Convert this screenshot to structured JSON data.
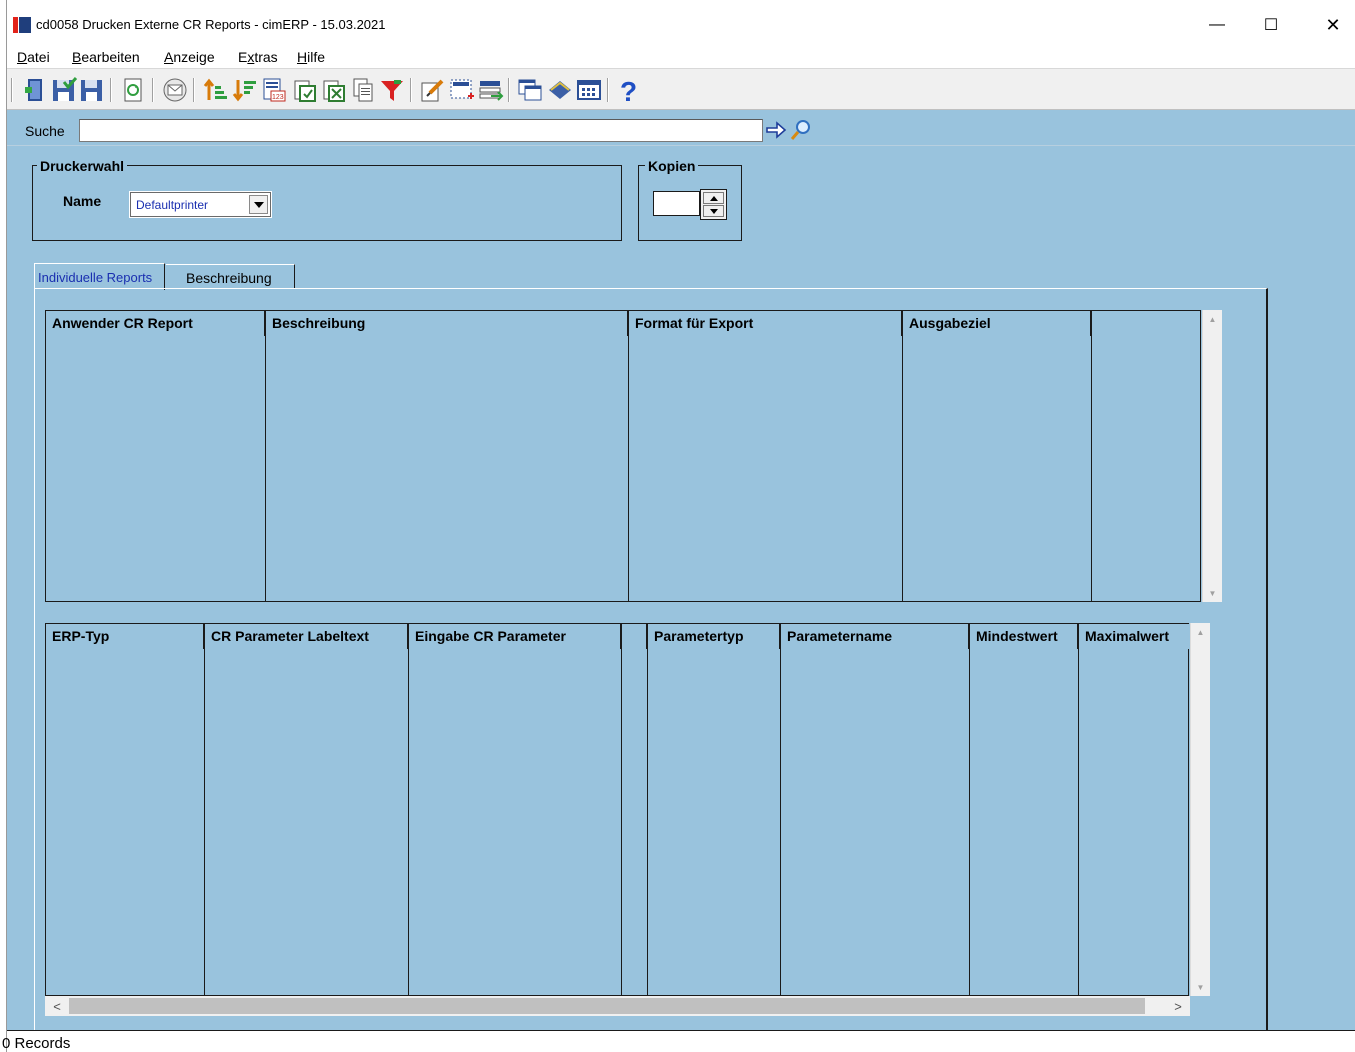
{
  "window": {
    "title": "cd0058 Drucken Externe CR Reports - cimERP - 15.03.2021",
    "minimize": "—",
    "maximize": "☐",
    "close": "✕"
  },
  "menu": [
    {
      "label_u": "D",
      "label_rest": "atei"
    },
    {
      "label_u": "B",
      "label_rest": "earbeiten"
    },
    {
      "label_u": "A",
      "label_rest": "nzeige"
    },
    {
      "label_pre": "E",
      "label_u": "x",
      "label_rest": "tras"
    },
    {
      "label_u": "H",
      "label_rest": "ilfe"
    }
  ],
  "toolbar_icons": [
    "exit-door-icon",
    "save-all-icon",
    "save-icon",
    "refresh-icon",
    "mail-icon",
    "sort-ascending-icon",
    "sort-descending-icon",
    "calendar-icon",
    "export-icon",
    "excel-icon",
    "copy-icon",
    "filter-icon",
    "edit-icon",
    "select-icon",
    "transfer-icon",
    "windows-icon",
    "book-icon",
    "grid-icon",
    "help-icon"
  ],
  "search": {
    "label": "Suche",
    "value": ""
  },
  "printer": {
    "group_title": "Druckerwahl",
    "name_label": "Name",
    "selected": "Defaultprinter"
  },
  "copies": {
    "group_title": "Kopien",
    "value": ""
  },
  "tabs": [
    {
      "label": "Individuelle Reports",
      "active": true
    },
    {
      "label": "Beschreibung",
      "active": false
    }
  ],
  "grid1": {
    "columns": [
      "Anwender CR Report",
      "Beschreibung",
      "Format für Export",
      "Ausgabeziel",
      ""
    ],
    "rows": []
  },
  "grid2": {
    "columns": [
      "ERP-Typ",
      "CR Parameter Labeltext",
      "Eingabe CR Parameter",
      "",
      "Parametertyp",
      "Parametername",
      "Mindestwert",
      "Maximalwert"
    ],
    "rows": []
  },
  "status": {
    "text": "0 Records"
  },
  "colors": {
    "panel": "#99c3dd",
    "toolbar": "#f0f0f0",
    "accent_text": "#1a2fb0"
  }
}
